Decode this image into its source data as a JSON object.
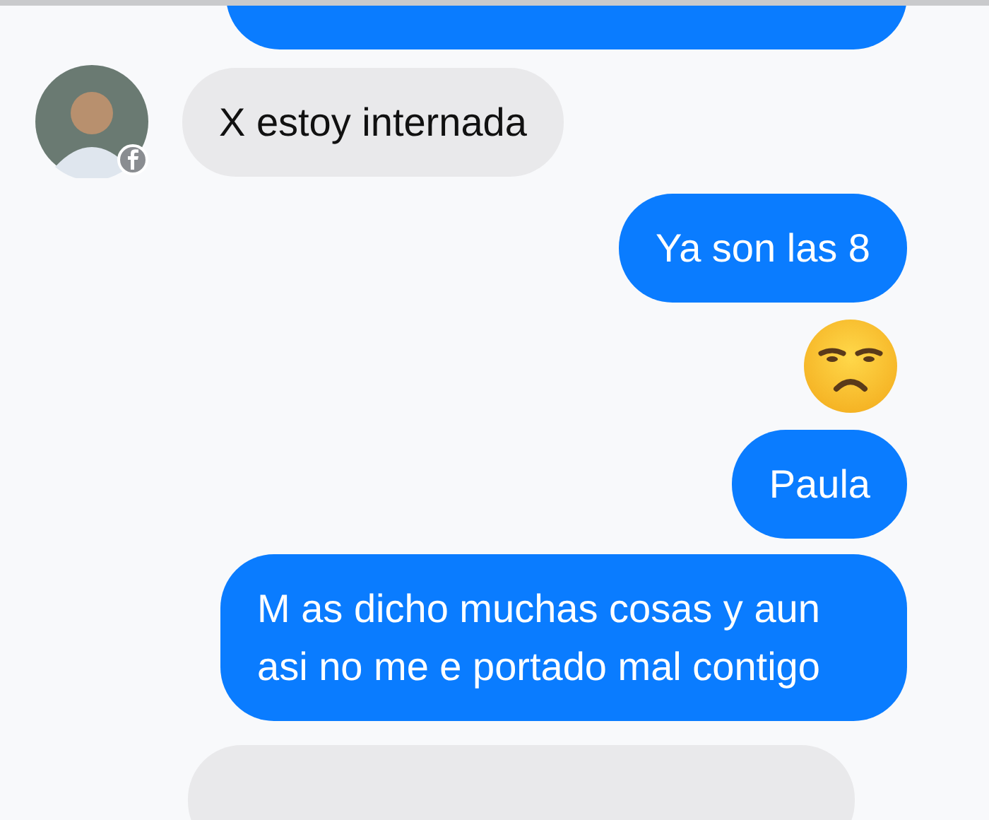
{
  "messages": [
    {
      "kind": "sent"
    },
    {
      "kind": "received",
      "text": "X estoy internada"
    },
    {
      "kind": "sent",
      "text": "Ya son las 8"
    },
    {
      "kind": "emoji"
    },
    {
      "kind": "sent",
      "text": "Paula"
    },
    {
      "kind": "sent",
      "text": "M as dicho muchas cosas y aun asi no me e portado mal contigo"
    },
    {
      "kind": "received"
    }
  ]
}
